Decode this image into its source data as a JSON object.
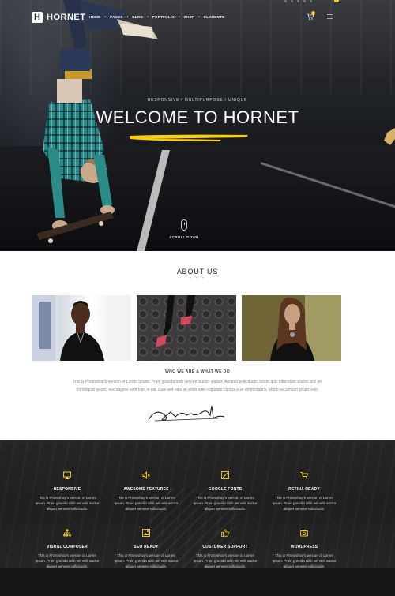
{
  "brand": {
    "logo_letter": "H",
    "name": "HORNET"
  },
  "nav": {
    "items": [
      "HOME",
      "PAGES",
      "BLOG",
      "PORTFOLIO",
      "SHOP",
      "ELEMENTS"
    ]
  },
  "hero": {
    "subtitle": "RESPONSIVE / MULTIPURPOSE / UNIQUE",
    "title": "WELCOME TO HORNET",
    "scroll_label": "SCROLL DOWN",
    "accent_color": "#f6cf15"
  },
  "about": {
    "title": "ABOUT US",
    "dots": "• • •",
    "who_heading": "WHO WE ARE & WHAT WE DO",
    "body": "This is Photoshop's version of Lorem Ipsum. Proin gravida nibh vel velit auctor aliquet. Aenean sollicitudin, lorem quis bibendum auctor, nisi elit consequat ipsum, nec sagittis sem nibh id elit. Duis sed odio sit amet nibh vulputate cursus a sit amet mauris. Morbi accumsan ipsum velit."
  },
  "features": [
    {
      "icon": "monitor-icon",
      "title": "RESPONSIVE",
      "desc": "This is Photoshop's version of Lorem Ipsum. Proin gravida nibh vel velit auctor aliquet aenean sollicitudin."
    },
    {
      "icon": "mute-speaker-icon",
      "title": "AWESOME FEATURES",
      "desc": "This is Photoshop's version of Lorem Ipsum. Proin gravida nibh vel velit auctor aliquet aenean sollicitudin."
    },
    {
      "icon": "font-icon",
      "title": "GOOGLE FONTS",
      "desc": "This is Photoshop's version of Lorem Ipsum. Proin gravida nibh vel velit auctor aliquet aenean sollicitudin."
    },
    {
      "icon": "cart-icon",
      "title": "RETINA READY",
      "desc": "This is Photoshop's version of Lorem Ipsum. Proin gravida nibh vel velit auctor aliquet aenean sollicitudin."
    },
    {
      "icon": "sitemap-icon",
      "title": "VISUAL COMPOSER",
      "desc": "This is Photoshop's version of Lorem Ipsum. Proin gravida nibh vel velit auctor aliquet aenean sollicitudin."
    },
    {
      "icon": "image-icon",
      "title": "SEO READY",
      "desc": "This is Photoshop's version of Lorem Ipsum. Proin gravida nibh vel velit auctor aliquet aenean sollicitudin."
    },
    {
      "icon": "thumbs-up-icon",
      "title": "CUSTOMER SUPPORT",
      "desc": "This is Photoshop's version of Lorem Ipsum. Proin gravida nibh vel velit auctor aliquet aenean sollicitudin."
    },
    {
      "icon": "camera-icon",
      "title": "WORDPRESS",
      "desc": "This is Photoshop's version of Lorem Ipsum. Proin gravida nibh vel velit auctor aliquet aenean sollicitudin."
    }
  ]
}
